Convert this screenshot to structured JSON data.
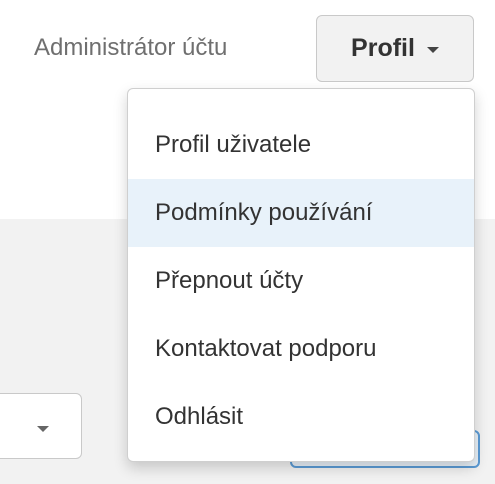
{
  "header": {
    "account_role": "Administrátor účtu",
    "profile_button_label": "Profil"
  },
  "profile_menu": {
    "items": [
      {
        "label": "Profil uživatele"
      },
      {
        "label": "Podmínky používání"
      },
      {
        "label": "Přepnout účty"
      },
      {
        "label": "Kontaktovat podporu"
      },
      {
        "label": "Odhlásit"
      }
    ],
    "highlighted_item": "Podmínky používání"
  },
  "colors": {
    "menu_highlight": "#e8f2fa",
    "content_background": "#f2f2f2",
    "primary_border": "#5b9bd5"
  },
  "icons": {
    "profile_caret": "chevron-down-icon",
    "select_caret": "chevron-down-icon"
  }
}
